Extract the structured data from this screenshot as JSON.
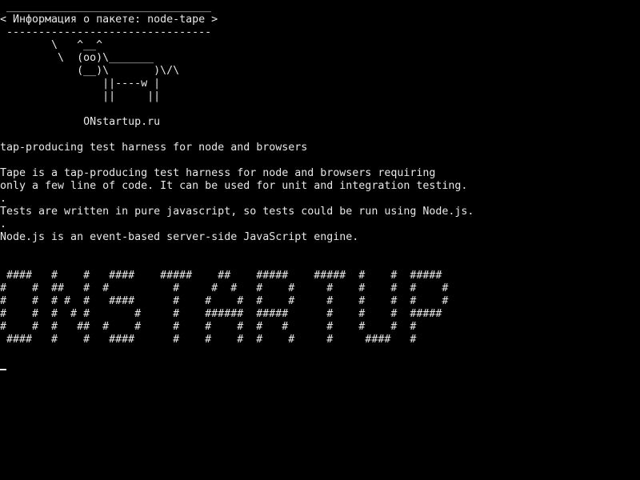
{
  "colors": {
    "background": "#000000",
    "text": "#e8e8e8"
  },
  "terminal": {
    "lines": [
      " ________________________________",
      "< Информация о пакете: node-tape >",
      " --------------------------------",
      "        \\   ^__^",
      "         \\  (oo)\\_______",
      "            (__)\\       )\\/\\",
      "                ||----w |",
      "                ||     ||",
      "",
      "             ONstartup.ru",
      "",
      "tap-producing test harness for node and browsers",
      "",
      "Tape is a tap-producing test harness for node and browsers requiring",
      "only a few line of code. It can be used for unit and integration testing.",
      ".",
      "Tests are written in pure javascript, so tests could be run using Node.js.",
      ".",
      "Node.js is an event-based server-side JavaScript engine.",
      "",
      "",
      " ####   #    #   ####    #####    ##    #####    #####  #    #  #####",
      "#    #  ##   #  #          #     #  #   #    #     #    #    #  #    #",
      "#    #  # #  #   ####      #    #    #  #    #     #    #    #  #    #",
      "#    #  #  # #       #     #    ######  #####      #    #    #  #####",
      "#    #  #   ##  #    #     #    #    #  #   #      #    #    #  #",
      " ####   #    #   ####      #    #    #  #    #     #     ####   #"
    ]
  }
}
